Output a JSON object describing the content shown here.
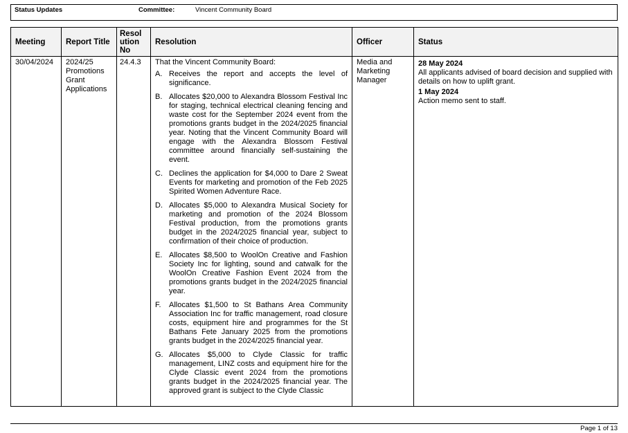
{
  "header": {
    "title": "Status Updates",
    "committee_label": "Committee:",
    "committee_value": "Vincent Community Board"
  },
  "table": {
    "columns": [
      "Meeting",
      "Report Title",
      "Resol ution No",
      "Resolution",
      "Officer",
      "Status"
    ],
    "row": {
      "meeting": "30/04/2024",
      "report_title": "2024/25 Promotions Grant Applications",
      "resolution_no": "24.4.3",
      "resolution_intro": "That the Vincent Community Board:",
      "resolution_items": [
        {
          "letter": "A.",
          "text": "Receives the report and accepts the level of significance."
        },
        {
          "letter": "B.",
          "text": "Allocates $20,000 to Alexandra Blossom Festival Inc for staging, technical electrical cleaning fencing and waste cost for the September 2024 event from the promotions grants budget in the 2024/2025 financial year. Noting that the Vincent Community Board will engage with the Alexandra Blossom Festival committee around financially self-sustaining the event."
        },
        {
          "letter": "C.",
          "text": "Declines the application for $4,000 to Dare 2 Sweat Events for marketing and promotion of the Feb 2025 Spirited Women Adventure Race."
        },
        {
          "letter": "D.",
          "text": "Allocates $5,000 to Alexandra Musical Society for marketing and promotion of the 2024 Blossom Festival production, from the promotions grants budget in the 2024/2025 financial year, subject to confirmation of their choice of production."
        },
        {
          "letter": "E.",
          "text": "Allocates $8,500 to WoolOn Creative and Fashion Society Inc for lighting, sound and catwalk for the WoolOn Creative Fashion Event 2024 from the promotions grants budget in the 2024/2025 financial year."
        },
        {
          "letter": "F.",
          "text": "Allocates $1,500 to St Bathans Area Community Association Inc for traffic management, road closure costs, equipment hire and programmes for the St Bathans Fete January 2025 from the promotions grants budget in the 2024/2025 financial year."
        },
        {
          "letter": "G.",
          "text": "Allocates $5,000 to Clyde Classic for traffic management, LINZ costs and equipment hire for the Clyde Classic event 2024 from the promotions grants budget in the 2024/2025 financial year. The approved grant is subject to the Clyde Classic"
        }
      ],
      "officer": "Media and Marketing Manager",
      "status_entries": [
        {
          "date": "28 May 2024",
          "text": "All applicants advised of board decision and supplied with details on how to uplift grant."
        },
        {
          "date": "1 May 2024",
          "text": "Action memo sent to staff."
        }
      ]
    }
  },
  "footer": {
    "page": "Page 1 of 13"
  }
}
